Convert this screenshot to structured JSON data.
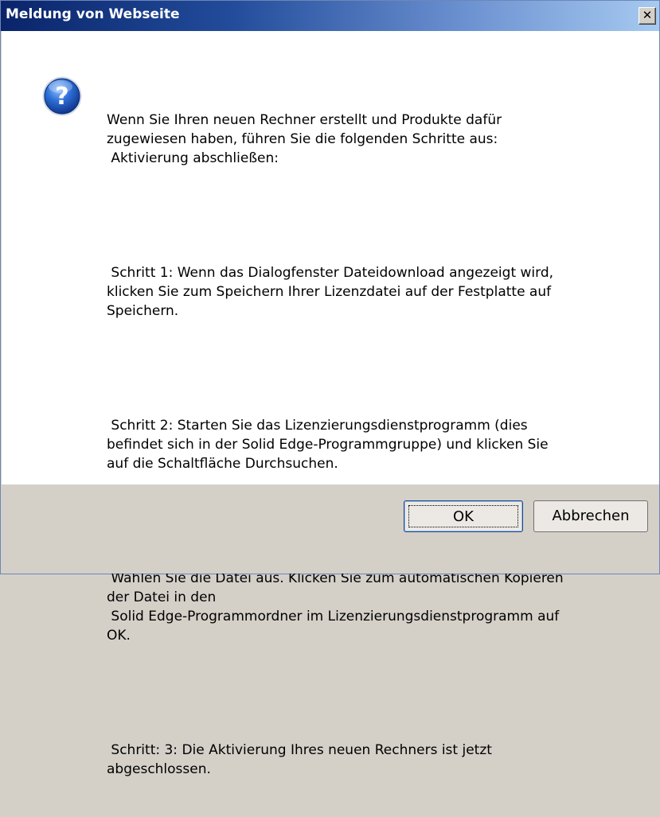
{
  "dialog": {
    "title": "Meldung von Webseite",
    "close_label": "✕",
    "icon": "question-icon",
    "message_paragraphs": [
      "Wenn Sie Ihren neuen Rechner erstellt und Produkte dafür\nzugewiesen haben, führen Sie die folgenden Schritte aus:\n Aktivierung abschließen:",
      " Schritt 1: Wenn das Dialogfenster Dateidownload angezeigt wird,\nklicken Sie zum Speichern Ihrer Lizenzdatei auf der Festplatte auf\nSpeichern.",
      " Schritt 2: Starten Sie das Lizenzierungsdienstprogramm (dies\nbefindet sich in der Solid Edge-Programmgruppe) und klicken Sie\nauf die Schaltfläche Durchsuchen.",
      " Wählen Sie die Datei aus. Klicken Sie zum automatischen Kopieren\nder Datei in den\n Solid Edge-Programmordner im Lizenzierungsdienstprogramm auf\nOK.",
      " Schritt: 3: Die Aktivierung Ihres neuen Rechners ist jetzt\nabgeschlossen."
    ],
    "buttons": {
      "ok_label": "OK",
      "cancel_label": "Abbrechen"
    },
    "colors": {
      "title_bar_start": "#0a246a",
      "title_bar_end": "#a6caf0",
      "content_bg": "#ffffff",
      "frame_bg": "#d4d0c8"
    }
  }
}
